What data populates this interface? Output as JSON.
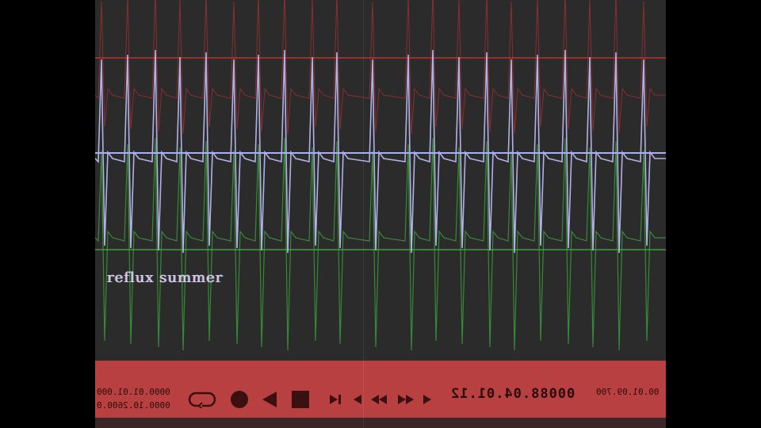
{
  "overlay": {
    "title": "reflux summer"
  },
  "transport": {
    "timecode_left_top": "0000.01.01.000",
    "timecode_left_bottom": "0000.10.2600.0",
    "timecode_main": "00088.04.01.12",
    "timecode_right": "00.01.09.700",
    "controls": [
      {
        "name": "loop-icon"
      },
      {
        "name": "record-icon"
      },
      {
        "name": "play-reverse-icon"
      },
      {
        "name": "stop-icon"
      },
      {
        "name": "skip-to-end-icon"
      },
      {
        "name": "step-back-icon"
      },
      {
        "name": "rewind-icon"
      },
      {
        "name": "fast-forward-icon"
      },
      {
        "name": "step-forward-icon"
      }
    ]
  },
  "colors": {
    "background": "#2b2b2b",
    "transport_bar": "#b84040",
    "trace_red": "#b03030",
    "trace_blue": "#b8b8f0",
    "trace_green": "#3a9a3a",
    "baseline_red": "#c03030",
    "baseline_blue": "#a8b0f0",
    "baseline_green": "#40a040"
  }
}
